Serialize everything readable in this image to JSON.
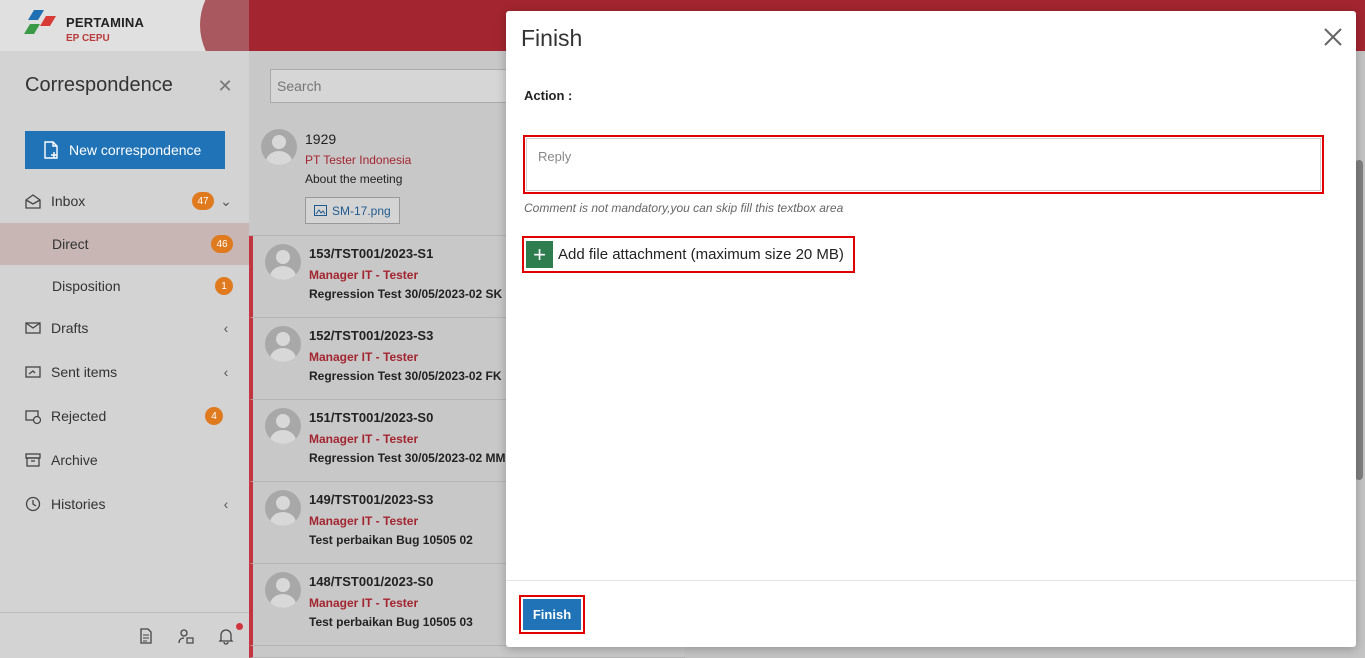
{
  "brand": {
    "name": "PERTAMINA",
    "sub": "EP CEPU"
  },
  "sidebar": {
    "title": "Correspondence",
    "new_label": "New correspondence",
    "items": [
      {
        "label": "Inbox",
        "badge": "47"
      },
      {
        "label": "Direct",
        "badge": "46"
      },
      {
        "label": "Disposition",
        "badge": "1"
      },
      {
        "label": "Drafts"
      },
      {
        "label": "Sent items"
      },
      {
        "label": "Rejected",
        "badge": "4"
      },
      {
        "label": "Archive"
      },
      {
        "label": "Histories"
      }
    ]
  },
  "search": {
    "placeholder": "Search"
  },
  "messages": [
    {
      "num": "1929",
      "from": "PT Tester Indonesia",
      "subject": "About the meeting",
      "attachment": "SM-17.png"
    },
    {
      "num": "153/TST001/2023-S1",
      "from": "Manager IT - Tester",
      "subject": "Regression Test 30/05/2023-02 SK"
    },
    {
      "num": "152/TST001/2023-S3",
      "from": "Manager IT - Tester",
      "subject": "Regression Test 30/05/2023-02 FK"
    },
    {
      "num": "151/TST001/2023-S0",
      "from": "Manager IT - Tester",
      "subject": "Regression Test 30/05/2023-02 MM"
    },
    {
      "num": "149/TST001/2023-S3",
      "from": "Manager IT - Tester",
      "subject": "Test perbaikan Bug 10505 02"
    },
    {
      "num": "148/TST001/2023-S0",
      "from": "Manager IT - Tester",
      "subject": "Test perbaikan Bug 10505 03"
    }
  ],
  "modal": {
    "title": "Finish",
    "action_label": "Action :",
    "reply_placeholder": "Reply",
    "hint": "Comment is not mandatory,you can skip fill this textbox area",
    "attach_label": "Add file attachment (maximum size 20 MB)",
    "finish_label": "Finish"
  },
  "colors": {
    "primary": "#1f73b6",
    "brand_red": "#a32530",
    "badge": "#e07a1f",
    "highlight": "#e00000",
    "attach_green": "#2e7d4f"
  }
}
